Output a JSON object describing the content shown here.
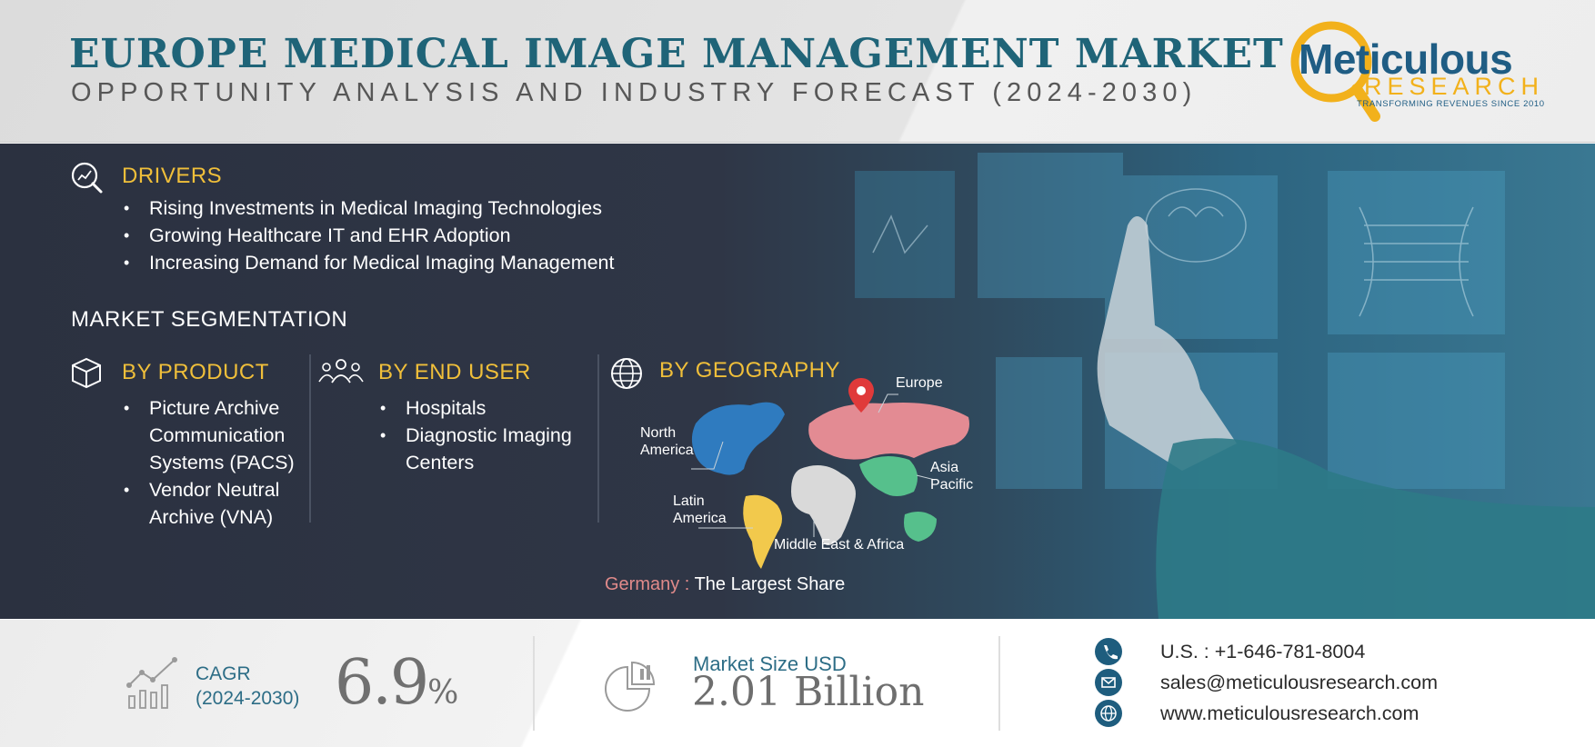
{
  "header": {
    "title": "EUROPE MEDICAL IMAGE MANAGEMENT MARKET",
    "subtitle": "OPPORTUNITY ANALYSIS AND INDUSTRY FORECAST (2024-2030)"
  },
  "logo": {
    "name": "Meticulous",
    "research": "RESEARCH",
    "tagline": "TRANSFORMING REVENUES SINCE 2010"
  },
  "drivers": {
    "heading": "DRIVERS",
    "icon": "chart-magnifier-icon",
    "items": [
      "Rising Investments in Medical Imaging Technologies",
      "Growing Healthcare IT and EHR Adoption",
      "Increasing Demand for Medical Imaging Management"
    ]
  },
  "segmentation": {
    "heading": "MARKET SEGMENTATION",
    "product": {
      "heading": "BY PRODUCT",
      "icon": "box-icon",
      "items": [
        "Picture Archive Communication Systems (PACS)",
        "Vendor Neutral Archive (VNA)"
      ]
    },
    "end_user": {
      "heading": "BY END USER",
      "icon": "users-icon",
      "items": [
        "Hospitals",
        "Diagnostic Imaging Centers"
      ]
    },
    "geography": {
      "heading": "BY GEOGRAPHY",
      "icon": "globe-icon",
      "regions": {
        "europe": "Europe",
        "north_america": "North America",
        "asia_pacific": "Asia Pacific",
        "latin_america": "Latin America",
        "mea": "Middle East & Africa"
      },
      "region_colors": {
        "north_america": "#2f7bbf",
        "europe_asia": "#e38b93",
        "asia_pacific": "#56c08c",
        "latin_america": "#f2c94c",
        "mea": "#d9d9d9"
      },
      "largest_share_country": "Germany :",
      "largest_share_text": "The Largest Share"
    }
  },
  "stats": {
    "cagr_label": "CAGR",
    "cagr_period": "(2024-2030)",
    "cagr_value": "6.9",
    "cagr_unit": "%",
    "market_size_label": "Market Size USD",
    "market_size_value": "2.01 Billion"
  },
  "contact": {
    "phone": "U.S. : +1-646-781-8004",
    "email": "sales@meticulousresearch.com",
    "website": "www.meticulousresearch.com"
  },
  "colors": {
    "title": "#1f6478",
    "accent_yellow": "#f0bf3a",
    "dark_panel": "#2f3646",
    "contact_icon": "#1e5d7e"
  }
}
